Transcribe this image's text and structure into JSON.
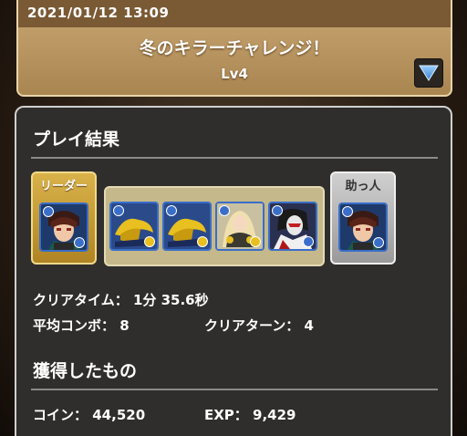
{
  "header": {
    "date": "2021/01/12 13:09",
    "title": "冬のキラーチャレンジ！",
    "level": "Lv4"
  },
  "result": {
    "section_title": "プレイ結果",
    "leader_label": "リーダー",
    "helper_label": "助っ人",
    "clear_time_label": "クリアタイム：",
    "clear_time_value": "1分 35.6秒",
    "avg_combo_label": "平均コンボ：",
    "avg_combo_value": "8",
    "clear_turns_label": "クリアターン：",
    "clear_turns_value": "4"
  },
  "rewards": {
    "section_title": "獲得したもの",
    "coin_label": "コイン：",
    "coin_value": "44,520",
    "exp_label": "EXP：",
    "exp_value": "9,429"
  },
  "colors": {
    "header_gold": "#b8935c",
    "leader_gold": "#c79a34",
    "panel_dark": "#302e2c",
    "attr_blue": "#3a6ec8",
    "attr_yellow": "#e8c020"
  }
}
